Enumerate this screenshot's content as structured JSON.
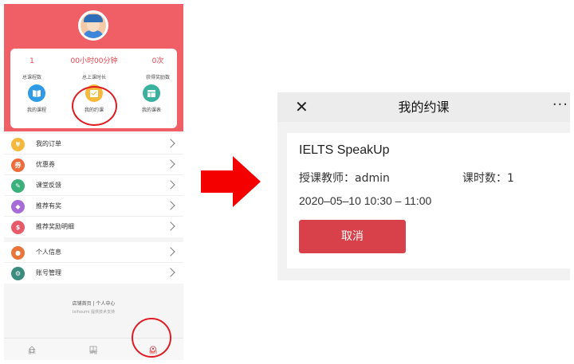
{
  "left_phone": {
    "stats": [
      {
        "value": "1",
        "label": "总课程数"
      },
      {
        "value": "00小时00分钟",
        "label": "总上课时长"
      },
      {
        "value": "0次",
        "label": "获得奖励数"
      }
    ],
    "quick_actions": [
      {
        "label": "我的课程",
        "icon": "book-icon",
        "color": "#2f9be6"
      },
      {
        "label": "我的约课",
        "icon": "calendar-check-icon",
        "color": "#f6b93b"
      },
      {
        "label": "我的课表",
        "icon": "schedule-icon",
        "color": "#3ab09e"
      }
    ],
    "menu_group1": [
      {
        "label": "我的订单",
        "icon": "yuan-icon",
        "color": "#f6b93b",
        "glyph": "¥"
      },
      {
        "label": "优惠券",
        "icon": "coupon-icon",
        "color": "#ef6b3a",
        "glyph": "券"
      },
      {
        "label": "课堂反馈",
        "icon": "feedback-icon",
        "color": "#3ab07a",
        "glyph": "✎"
      },
      {
        "label": "推荐有奖",
        "icon": "gift-icon",
        "color": "#a66bd9",
        "glyph": "◆"
      },
      {
        "label": "推荐奖励明细",
        "icon": "reward-detail-icon",
        "color": "#e85a6a",
        "glyph": "$"
      }
    ],
    "menu_group2": [
      {
        "label": "个人信息",
        "icon": "person-icon",
        "color": "#e8763a",
        "glyph": "●"
      },
      {
        "label": "账号管理",
        "icon": "gear-icon",
        "color": "#3a8c7e",
        "glyph": "⚙"
      }
    ],
    "footer_links": "店铺首页 | 个人中心",
    "powered_by": "Ixihoumi 提供技术支持",
    "tabs": [
      {
        "label": "首页",
        "icon": "home-icon"
      },
      {
        "label": "课程",
        "icon": "course-icon"
      },
      {
        "label": "我的",
        "icon": "profile-icon"
      }
    ]
  },
  "colors": {
    "header_red": "#ef5f65",
    "highlight_red": "#e01b22",
    "arrow_red": "#f40000",
    "cancel_button": "#d84149"
  },
  "right_panel": {
    "close_glyph": "✕",
    "title": "我的约课",
    "more_glyph": "···",
    "course_name": "IELTS SpeakUp",
    "teacher": "授课教师：admin",
    "lessons": "课时数：1",
    "time_range": "2020–05–10 10:30 – 11:00",
    "cancel_label": "取消"
  }
}
